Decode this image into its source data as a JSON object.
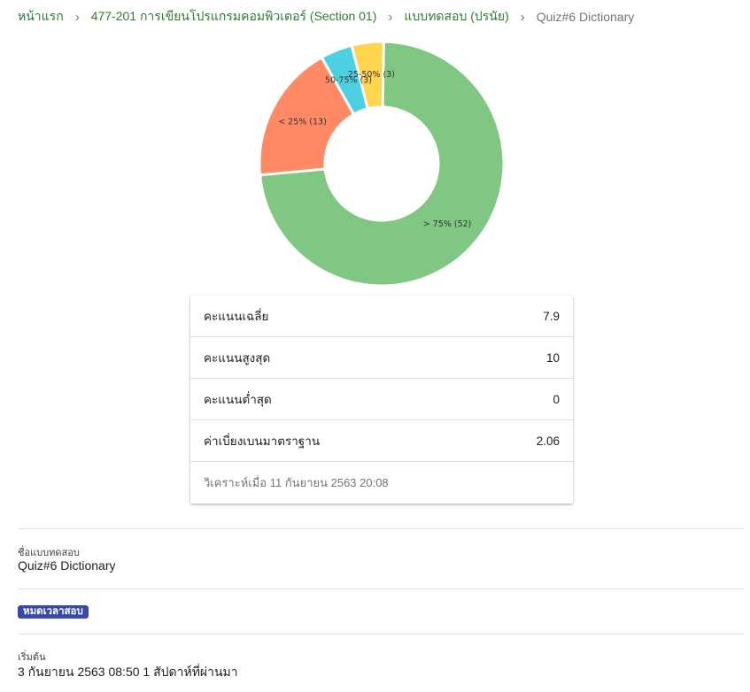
{
  "breadcrumb": {
    "items": [
      {
        "label": "หน้าแรก"
      },
      {
        "label": "477-201 การเขียนโปรแกรมคอมพิวเตอร์ (Section 01)"
      },
      {
        "label": "แบบทดสอบ (ปรนัย)"
      }
    ],
    "current": "Quiz#6 Dictionary",
    "separator": "›"
  },
  "chart_data": {
    "type": "pie",
    "variant": "donut",
    "slices": [
      {
        "label": "> 75% (52)",
        "value": 52,
        "color": "#81c784"
      },
      {
        "label": "< 25% (13)",
        "value": 13,
        "color": "#ff8a65"
      },
      {
        "label": "50-75% (3)",
        "value": 3,
        "color": "#4dd0e1"
      },
      {
        "label": "25-50% (3)",
        "value": 3,
        "color": "#ffd54f"
      }
    ]
  },
  "stats": {
    "rows": [
      {
        "label": "คะแนนเฉลี่ย",
        "value": "7.9"
      },
      {
        "label": "คะแนนสูงสุด",
        "value": "10"
      },
      {
        "label": "คะแนนต่ำสุด",
        "value": "0"
      },
      {
        "label": "ค่าเบี่ยงเบนมาตราฐาน",
        "value": "2.06"
      }
    ],
    "analyzed_at": "วิเคราะห์เมื่อ 11 กันยายน 2563 20:08"
  },
  "details": {
    "quiz_name_label": "ชื่อแบบทดสอบ",
    "quiz_name": "Quiz#6 Dictionary",
    "status_badge": "หมดเวลาสอบ",
    "start_label": "เริ่มต้น",
    "start_value": "3 กันยายน 2563 08:50 1 สัปดาห์ที่ผ่านมา"
  }
}
